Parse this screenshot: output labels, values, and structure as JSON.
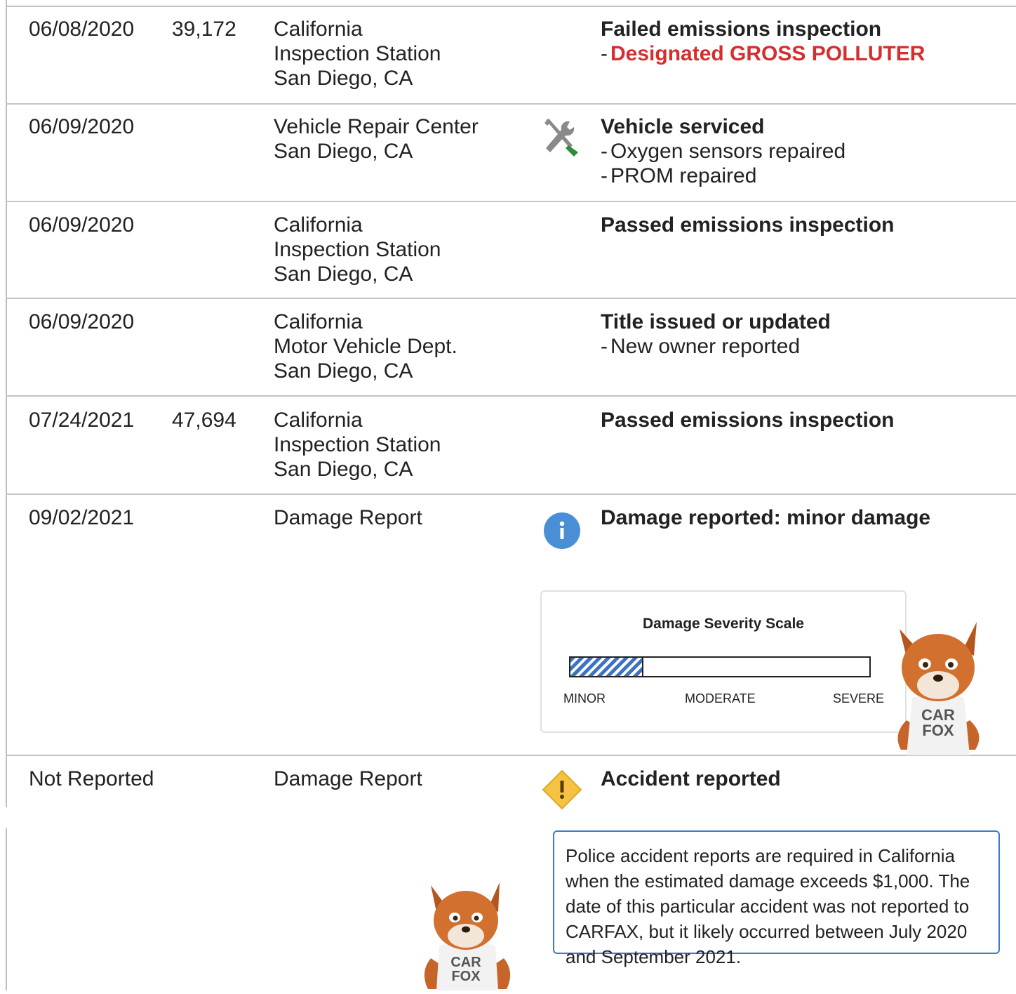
{
  "rows": [
    {
      "date": "06/08/2020",
      "odometer": "39,172",
      "source": [
        "California",
        "Inspection Station",
        "San Diego, CA"
      ],
      "event_title": "Failed emissions inspection",
      "details": [
        {
          "text": "Designated GROSS POLLUTER",
          "style": "red"
        }
      ]
    },
    {
      "date": "06/09/2020",
      "odometer": "",
      "source": [
        "Vehicle Repair Center",
        "San Diego, CA"
      ],
      "icon": "wrench-screwdriver-icon",
      "event_title": "Vehicle serviced",
      "details": [
        {
          "text": "Oxygen sensors repaired"
        },
        {
          "text": "PROM repaired"
        }
      ]
    },
    {
      "date": "06/09/2020",
      "odometer": "",
      "source": [
        "California",
        "Inspection Station",
        "San Diego, CA"
      ],
      "event_title": "Passed emissions inspection",
      "details": []
    },
    {
      "date": "06/09/2020",
      "odometer": "",
      "source": [
        "California",
        "Motor Vehicle Dept.",
        "San Diego, CA"
      ],
      "event_title": "Title issued or updated",
      "details": [
        {
          "text": "New owner reported"
        }
      ]
    },
    {
      "date": "07/24/2021",
      "odometer": "47,694",
      "source": [
        "California",
        "Inspection Station",
        "San Diego, CA"
      ],
      "event_title": "Passed emissions inspection",
      "details": []
    },
    {
      "date": "09/02/2021",
      "odometer": "",
      "source": [
        "Damage Report"
      ],
      "icon": "info-icon",
      "event_title": "Damage reported: minor damage",
      "details": []
    },
    {
      "date": "Not Reported",
      "odometer": "",
      "source": [
        "Damage Report"
      ],
      "icon": "warning-icon",
      "event_title": "Accident reported",
      "details": []
    }
  ],
  "severity_scale": {
    "title": "Damage Severity Scale",
    "level_fraction": 0.24,
    "labels": [
      "MINOR",
      "MODERATE",
      "SEVERE"
    ],
    "fill_color": "#3a72c4"
  },
  "accident_note": "Police accident reports are required in California when the estimated damage exceeds $1,000. The date of this particular accident was not reported to CARFAX, but it likely occurred between July 2020 and September 2021.",
  "mascot": {
    "shirt_text_line1": "CAR",
    "shirt_text_line2": "FOX"
  },
  "colors": {
    "alert_red": "#d32f2f",
    "info_blue": "#4a8fd6",
    "warning_yellow": "#f6c244",
    "note_border": "#3b7cc9",
    "wrench_green": "#2e8b3a"
  }
}
